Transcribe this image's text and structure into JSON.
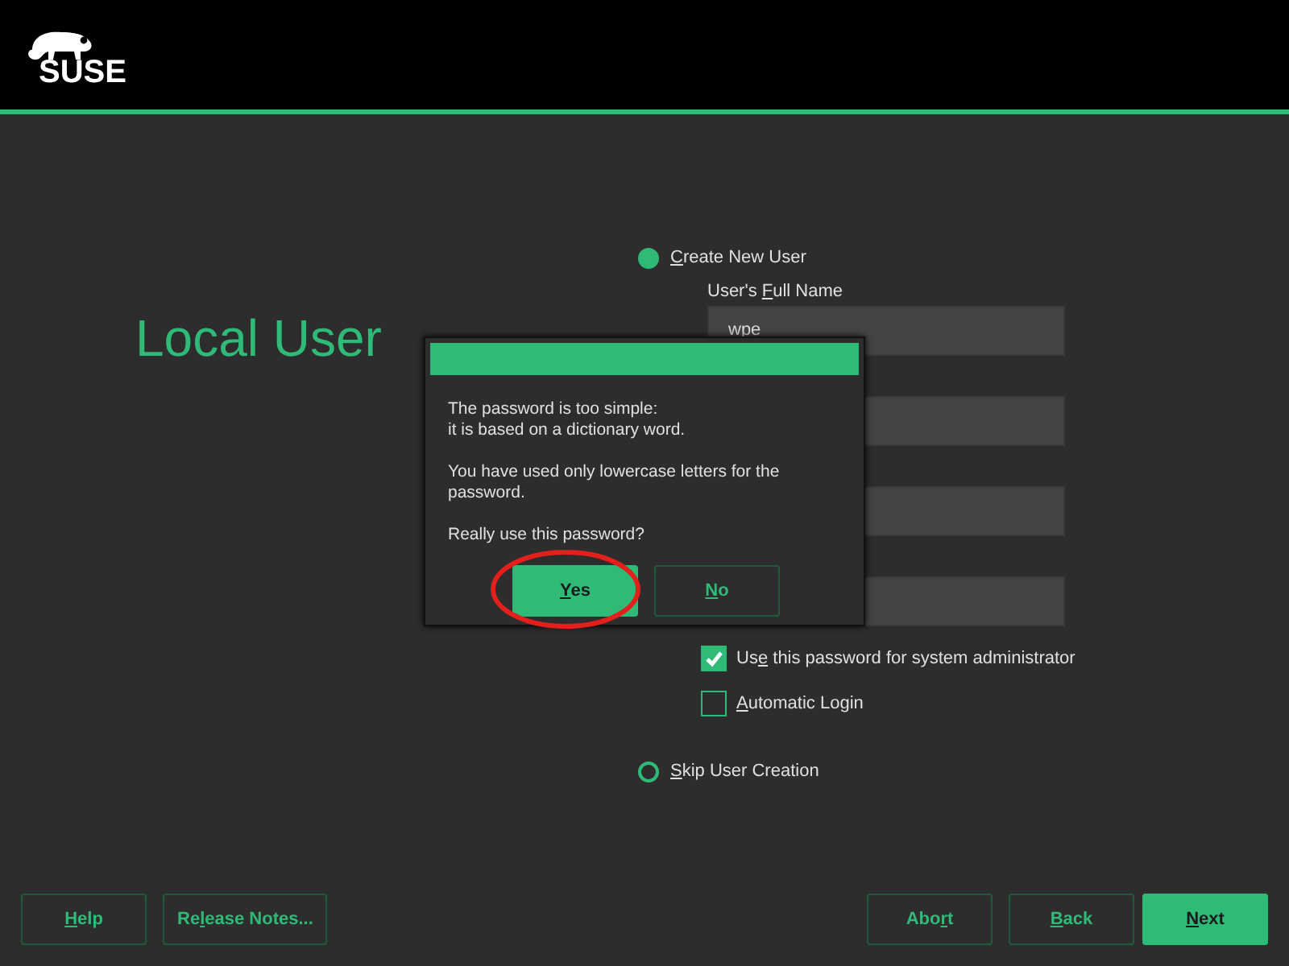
{
  "header": {
    "logo_text": "SUSE"
  },
  "title": "Local User",
  "create_user": {
    "label": {
      "key": "C",
      "after": "reate New User"
    },
    "selected": true,
    "fields": [
      {
        "kind": "labeled",
        "label": {
          "before": "User's ",
          "key": "F",
          "after": "ull Name"
        },
        "value": "wpe"
      },
      {
        "kind": "plain"
      },
      {
        "kind": "plain"
      },
      {
        "kind": "plain"
      }
    ],
    "checkboxes": [
      {
        "label": {
          "before": "Us",
          "key": "e",
          "after": " this password for system administrator"
        },
        "checked": true
      },
      {
        "label": {
          "key": "A",
          "after": "utomatic Login"
        },
        "checked": false
      }
    ]
  },
  "skip_user": {
    "label": {
      "key": "S",
      "after": "kip User Creation"
    },
    "selected": false
  },
  "dialog": {
    "paragraphs": [
      "The password is too simple:\nit is based on a dictionary word.",
      "You have used only lowercase letters for the password.",
      "Really use this password?"
    ],
    "buttons": [
      {
        "label": {
          "key": "Y",
          "after": "es"
        },
        "primary": true,
        "circled": true
      },
      {
        "label": {
          "key": "N",
          "after": "o"
        },
        "primary": false,
        "circled": false
      }
    ]
  },
  "footer": {
    "left": [
      {
        "label": {
          "key": "H",
          "after": "elp"
        },
        "primary": false
      },
      {
        "label": {
          "before": "Re",
          "key": "l",
          "after": "ease Notes..."
        },
        "primary": false
      }
    ],
    "right": [
      {
        "label": {
          "before": "Abo",
          "key": "r",
          "after": "t"
        },
        "primary": false
      },
      {
        "label": {
          "key": "B",
          "after": "ack"
        },
        "primary": false
      },
      {
        "label": {
          "key": "N",
          "after": "ext"
        },
        "primary": true
      }
    ]
  }
}
